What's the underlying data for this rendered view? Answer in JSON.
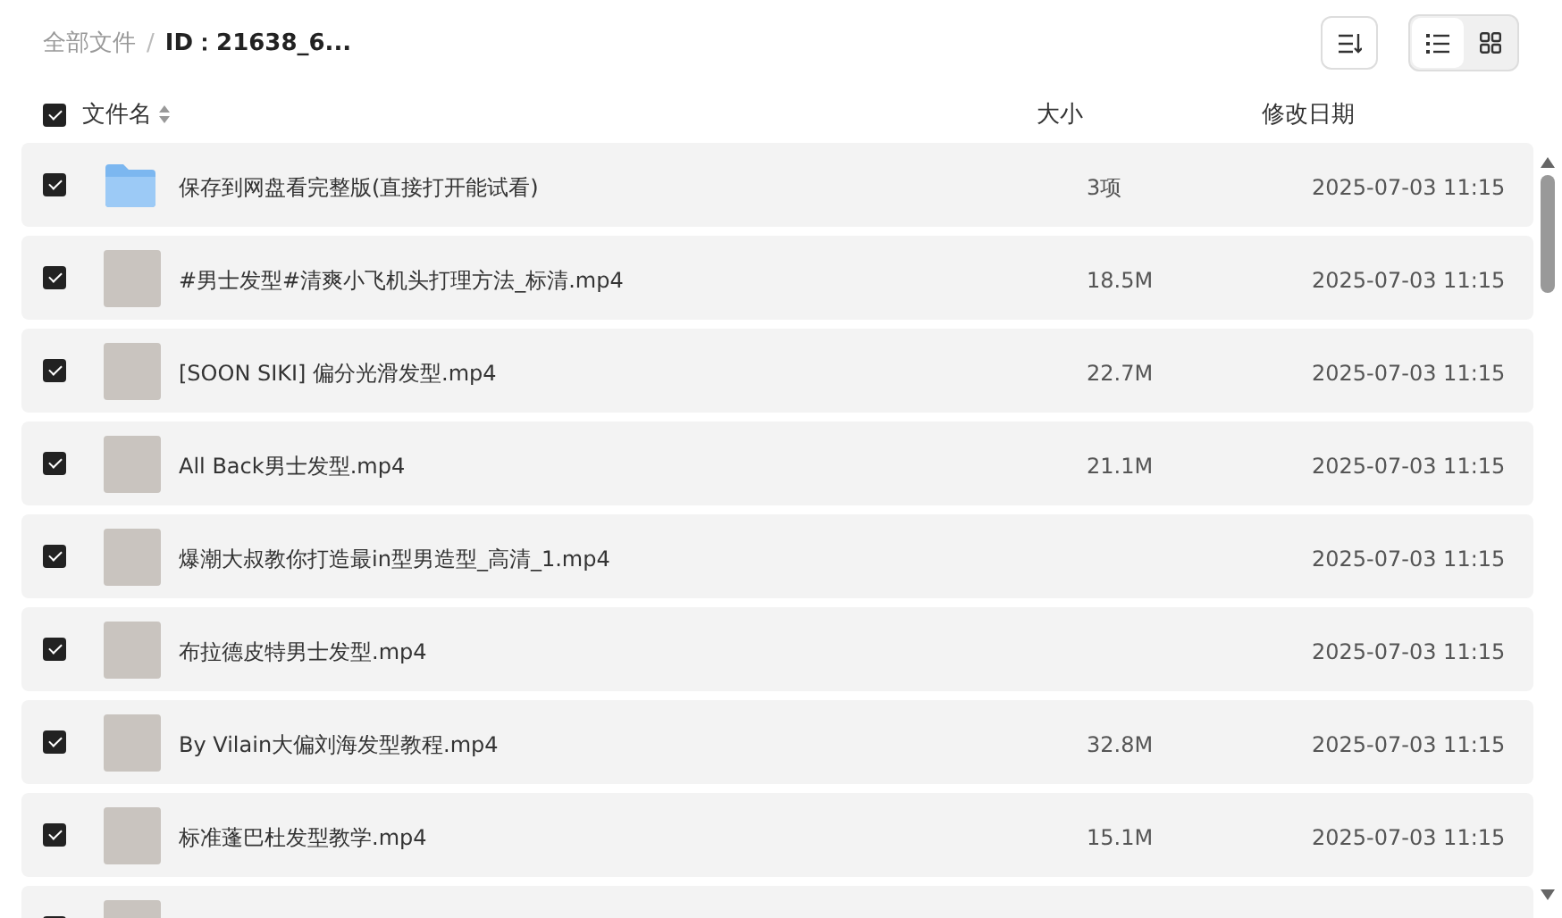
{
  "breadcrumb": [
    {
      "label": "全部文件",
      "current": false
    },
    {
      "label": "ID：21638_6...",
      "current": true
    }
  ],
  "breadcrumb_separator": "/",
  "view_modes": [
    {
      "kind": "list",
      "selected": true
    },
    {
      "kind": "grid",
      "selected": false
    }
  ],
  "columns": {
    "all_checked": true,
    "name": "文件名",
    "size": "大小",
    "date": "修改日期"
  },
  "files": [
    {
      "kind": "folder",
      "checked": true,
      "name": "保存到网盘看完整版(直接打开能试看)",
      "size": "3项",
      "date": "2025-07-03 11:15"
    },
    {
      "kind": "video",
      "checked": true,
      "name": "#男士发型#清爽小飞机头打理方法_标清.mp4",
      "size": "18.5M",
      "date": "2025-07-03 11:15"
    },
    {
      "kind": "video",
      "checked": true,
      "name": "[SOON SIKI] 偏分光滑发型.mp4",
      "size": "22.7M",
      "date": "2025-07-03 11:15"
    },
    {
      "kind": "video",
      "checked": true,
      "name": "All Back男士发型.mp4",
      "size": "21.1M",
      "date": "2025-07-03 11:15"
    },
    {
      "kind": "video",
      "checked": true,
      "name": "爆潮大叔教你打造最in型男造型_高清_1.mp4",
      "date": "2025-07-03 11:15"
    },
    {
      "kind": "video",
      "checked": true,
      "name": "布拉德皮特男士发型.mp4",
      "date": "2025-07-03 11:15"
    },
    {
      "kind": "video",
      "checked": true,
      "name": "By Vilain大偏刘海发型教程.mp4",
      "size": "32.8M",
      "date": "2025-07-03 11:15"
    },
    {
      "kind": "video",
      "checked": true,
      "name": "标准蓬巴杜发型教学.mp4",
      "size": "15.1M",
      "date": "2025-07-03 11:15"
    },
    {
      "kind": "video",
      "checked": true
    }
  ]
}
